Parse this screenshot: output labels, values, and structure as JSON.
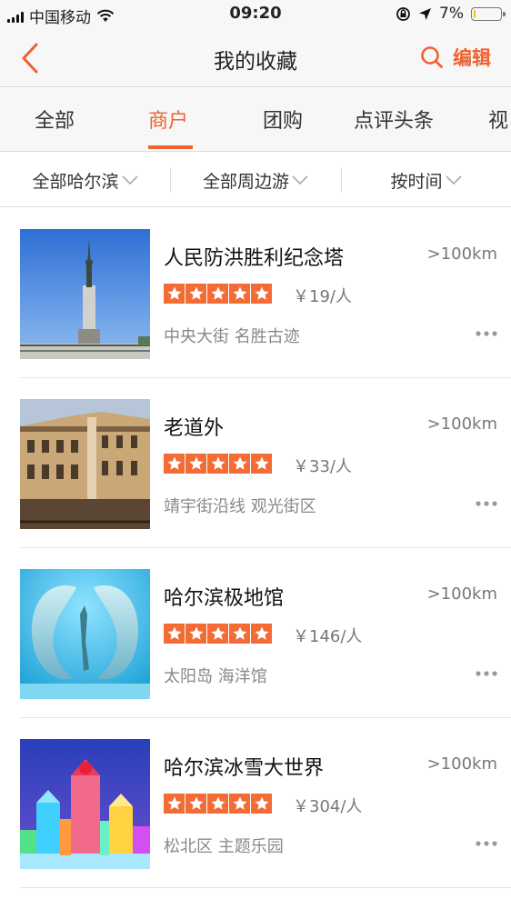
{
  "status_bar": {
    "carrier": "中国移动",
    "time": "09:20",
    "battery": "7%",
    "battery_level": 0.07
  },
  "header": {
    "title": "我的收藏",
    "edit_label": "编辑"
  },
  "tabs": [
    {
      "label": "全部"
    },
    {
      "label": "商户",
      "active": true
    },
    {
      "label": "团购"
    },
    {
      "label": "点评头条"
    },
    {
      "label": "视"
    }
  ],
  "filters": [
    {
      "label": "全部哈尔滨"
    },
    {
      "label": "全部周边游"
    },
    {
      "label": "按时间"
    }
  ],
  "items": [
    {
      "name": "人民防洪胜利纪念塔",
      "distance": ">100km",
      "rating": 5,
      "price": "￥19/人",
      "tags": "中央大街 名胜古迹"
    },
    {
      "name": "老道外",
      "distance": ">100km",
      "rating": 5,
      "price": "￥33/人",
      "tags": "靖宇街沿线 观光街区"
    },
    {
      "name": "哈尔滨极地馆",
      "distance": ">100km",
      "rating": 5,
      "price": "￥146/人",
      "tags": "太阳岛 海洋馆"
    },
    {
      "name": "哈尔滨冰雪大世界",
      "distance": ">100km",
      "rating": 5,
      "price": "￥304/人",
      "tags": "松北区 主题乐园"
    }
  ],
  "colors": {
    "accent": "#f06230",
    "star_bg": "#f36c35",
    "battery_fill": "#f2c10d"
  }
}
